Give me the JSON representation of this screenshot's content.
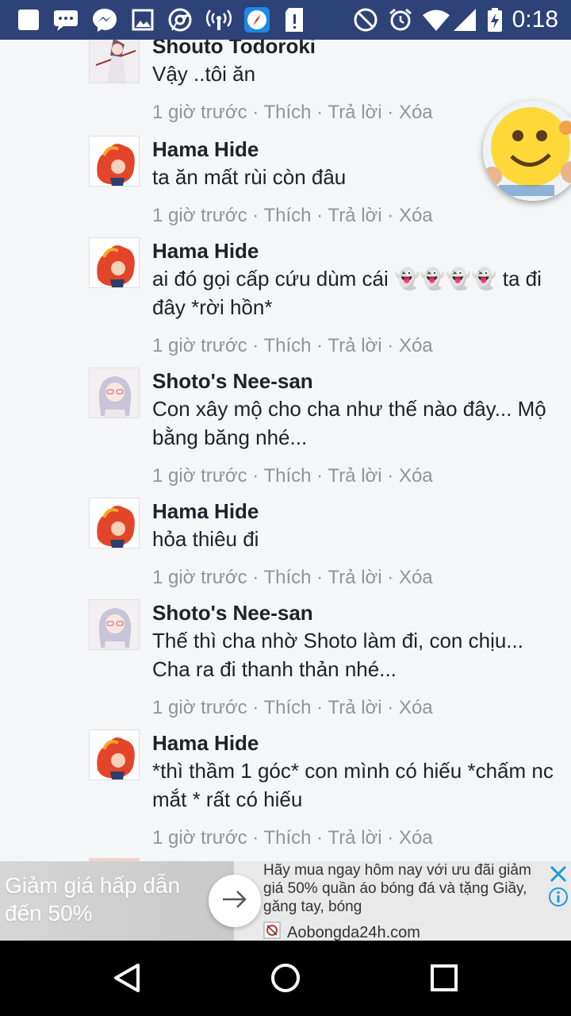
{
  "status_bar": {
    "time": "0:18",
    "left_icons": [
      "app-square-icon",
      "chat-bubbles-icon",
      "messenger-icon",
      "gallery-icon",
      "chrome-icon",
      "hotspot-icon",
      "compass-app-icon",
      "sd-card-alert-icon"
    ],
    "right_icons": [
      "do-not-disturb-icon",
      "alarm-icon",
      "wifi-icon",
      "signal-icon",
      "battery-charging-icon"
    ]
  },
  "comments": [
    {
      "name": "Shouto Todoroki",
      "text": "Vậy ..tôi ăn",
      "avatar": "todoroki"
    },
    {
      "name": "Hama Hide",
      "text": "ta ăn mất rùi còn đâu",
      "avatar": "hama"
    },
    {
      "name": "Hama Hide",
      "text": "ai đó gọi cấp cứu dùm cái 👻👻👻👻 ta đi đây *rời hồn*",
      "avatar": "hama"
    },
    {
      "name": "Shoto's Nee-san",
      "text": "Con xây mộ cho cha như thế nào đây... Mộ bằng băng nhé...",
      "avatar": "neesan"
    },
    {
      "name": "Hama Hide",
      "text": "hỏa thiêu đi",
      "avatar": "hama"
    },
    {
      "name": "Shoto's Nee-san",
      "text": "Thế thì cha nhờ Shoto làm đi, con chịu... Cha ra đi thanh thản nhé...",
      "avatar": "neesan"
    },
    {
      "name": "Hama Hide",
      "text": "*thì thầm 1 góc* con mình có hiếu *chấm nc mắt * rất có hiếu",
      "avatar": "hama"
    }
  ],
  "meta": {
    "time": "1 giờ trước",
    "sep": " · ",
    "like": "Thích",
    "reply": "Trả lời",
    "delete": "Xóa"
  },
  "ad": {
    "left_text": "Giảm giá hấp dẫn đến 50%",
    "description": "Hãy mua ngay hôm nay với ưu đãi giảm giá 50% quần áo bóng đá và tặng Giầy, găng tay, bóng",
    "site": "Aobongda24h.com"
  },
  "colors": {
    "status_bar": "#2d4277",
    "meta_text": "#90949c",
    "background": "#f5f6f7",
    "ad_close": "#1a9bd7"
  }
}
